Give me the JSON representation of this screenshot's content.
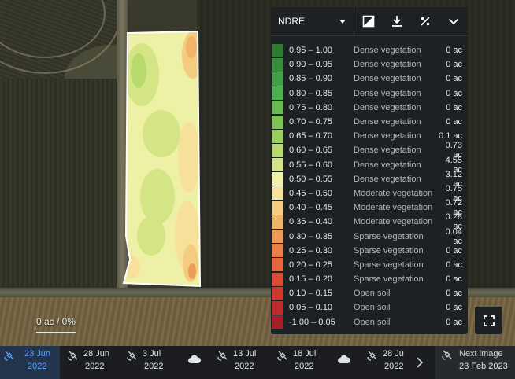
{
  "map": {
    "scale_label": "0 ac / 0%"
  },
  "legend": {
    "index_selected": "NDRE",
    "rows": [
      {
        "range": "0.95 – 1.00",
        "class": "Dense vegetation",
        "area": "0 ac",
        "color": "#2e7d32"
      },
      {
        "range": "0.90 – 0.95",
        "class": "Dense vegetation",
        "area": "0 ac",
        "color": "#388e3c"
      },
      {
        "range": "0.85 – 0.90",
        "class": "Dense vegetation",
        "area": "0 ac",
        "color": "#43a047"
      },
      {
        "range": "0.80 – 0.85",
        "class": "Dense vegetation",
        "area": "0 ac",
        "color": "#4caf50"
      },
      {
        "range": "0.75 – 0.80",
        "class": "Dense vegetation",
        "area": "0 ac",
        "color": "#66bb50"
      },
      {
        "range": "0.70 – 0.75",
        "class": "Dense vegetation",
        "area": "0 ac",
        "color": "#7cc452"
      },
      {
        "range": "0.65 – 0.70",
        "class": "Dense vegetation",
        "area": "0.1 ac",
        "color": "#9bcf5c"
      },
      {
        "range": "0.60 – 0.65",
        "class": "Dense vegetation",
        "area": "0.73 ac",
        "color": "#b8da6c"
      },
      {
        "range": "0.55 – 0.60",
        "class": "Dense vegetation",
        "area": "4.55 ac",
        "color": "#d4e585"
      },
      {
        "range": "0.50 – 0.55",
        "class": "Dense vegetation",
        "area": "3.12 ac",
        "color": "#eef0a6"
      },
      {
        "range": "0.45 – 0.50",
        "class": "Moderate vegetation",
        "area": "0.75 ac",
        "color": "#f6e09a"
      },
      {
        "range": "0.40 – 0.45",
        "class": "Moderate vegetation",
        "area": "0.72 ac",
        "color": "#f4cc80"
      },
      {
        "range": "0.35 – 0.40",
        "class": "Moderate vegetation",
        "area": "0.28 ac",
        "color": "#f0b36a"
      },
      {
        "range": "0.30 – 0.35",
        "class": "Sparse vegetation",
        "area": "0.04 ac",
        "color": "#ec9a58"
      },
      {
        "range": "0.25 – 0.30",
        "class": "Sparse vegetation",
        "area": "0 ac",
        "color": "#e8804a"
      },
      {
        "range": "0.20 – 0.25",
        "class": "Sparse vegetation",
        "area": "0 ac",
        "color": "#e2663e"
      },
      {
        "range": "0.15 – 0.20",
        "class": "Sparse vegetation",
        "area": "0 ac",
        "color": "#da4e35"
      },
      {
        "range": "0.10 – 0.15",
        "class": "Open soil",
        "area": "0 ac",
        "color": "#cf3a30"
      },
      {
        "range": "0.05 – 0.10",
        "class": "Open soil",
        "area": "0 ac",
        "color": "#c02b2c"
      },
      {
        "range": "-1.00 – 0.05",
        "class": "Open soil",
        "area": "0 ac",
        "color": "#a81e26"
      }
    ]
  },
  "timeline": {
    "items": [
      {
        "type": "satellite",
        "day": "23 Jun",
        "year": "2022",
        "active": true
      },
      {
        "type": "satellite",
        "day": "28 Jun",
        "year": "2022",
        "active": false
      },
      {
        "type": "satellite",
        "day": "3 Jul",
        "year": "2022",
        "active": false
      },
      {
        "type": "cloud"
      },
      {
        "type": "satellite",
        "day": "13 Jul",
        "year": "2022",
        "active": false
      },
      {
        "type": "satellite",
        "day": "18 Jul",
        "year": "2022",
        "active": false
      },
      {
        "type": "cloud"
      },
      {
        "type": "satellite",
        "day": "28 Ju",
        "year": "2022",
        "active": false
      }
    ],
    "next_label": "Next image",
    "next_date": "23 Feb 2023"
  }
}
